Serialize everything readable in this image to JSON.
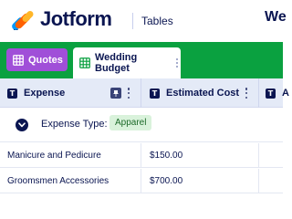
{
  "header": {
    "brand": "Jotform",
    "app_name": "Tables",
    "title_peek": "We"
  },
  "tabs": [
    {
      "label": "Quotes",
      "color": "#a04fd8"
    },
    {
      "label": "Wedding Budget",
      "active": true
    }
  ],
  "columns": [
    {
      "type_letter": "T",
      "label": "Expense"
    },
    {
      "type_letter": "T",
      "label": "Estimated Cost"
    },
    {
      "type_letter": "T",
      "label": "A"
    }
  ],
  "group": {
    "label": "Expense Type:",
    "value": "Apparel"
  },
  "rows": [
    {
      "expense": "Manicure and Pedicure",
      "estimated_cost": "$150.00"
    },
    {
      "expense": "Groomsmen Accessories",
      "estimated_cost": "$700.00"
    }
  ],
  "colors": {
    "tabbar": "#0aa140",
    "header_row": "#e4eaf7",
    "badge_bg": "#d9f2db",
    "brand_text": "#0a1551"
  }
}
